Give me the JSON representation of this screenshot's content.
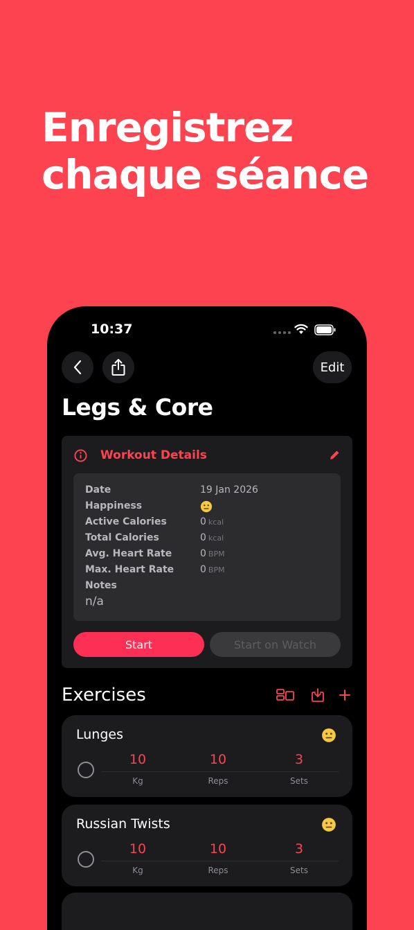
{
  "headline": {
    "line1": "Enregistrez",
    "line2": "chaque séance"
  },
  "status_bar": {
    "time": "10:37"
  },
  "nav": {
    "edit_label": "Edit"
  },
  "workout": {
    "title": "Legs & Core",
    "details_title": "Workout Details",
    "rows": [
      {
        "label": "Date",
        "value": "19 Jan 2026",
        "unit": ""
      },
      {
        "label": "Happiness",
        "value": "",
        "unit": ""
      },
      {
        "label": "Active Calories",
        "value": "0",
        "unit": "kcal"
      },
      {
        "label": "Total Calories",
        "value": "0",
        "unit": "kcal"
      },
      {
        "label": "Avg. Heart Rate",
        "value": "0",
        "unit": "BPM"
      },
      {
        "label": "Max. Heart Rate",
        "value": "0",
        "unit": "BPM"
      },
      {
        "label": "Notes",
        "value": "",
        "unit": ""
      }
    ],
    "notes_value": "n/a",
    "start_label": "Start",
    "start_watch_label": "Start on Watch"
  },
  "exercises": {
    "title": "Exercises",
    "items": [
      {
        "name": "Lunges",
        "weight": "10",
        "weight_unit": "Kg",
        "reps": "10",
        "reps_unit": "Reps",
        "sets": "3",
        "sets_unit": "Sets"
      },
      {
        "name": "Russian Twists",
        "weight": "10",
        "weight_unit": "Kg",
        "reps": "10",
        "reps_unit": "Reps",
        "sets": "3",
        "sets_unit": "Sets"
      }
    ]
  },
  "colors": {
    "background": "#fe4350",
    "accent": "#fe2f55",
    "card": "#1c1c1e"
  }
}
